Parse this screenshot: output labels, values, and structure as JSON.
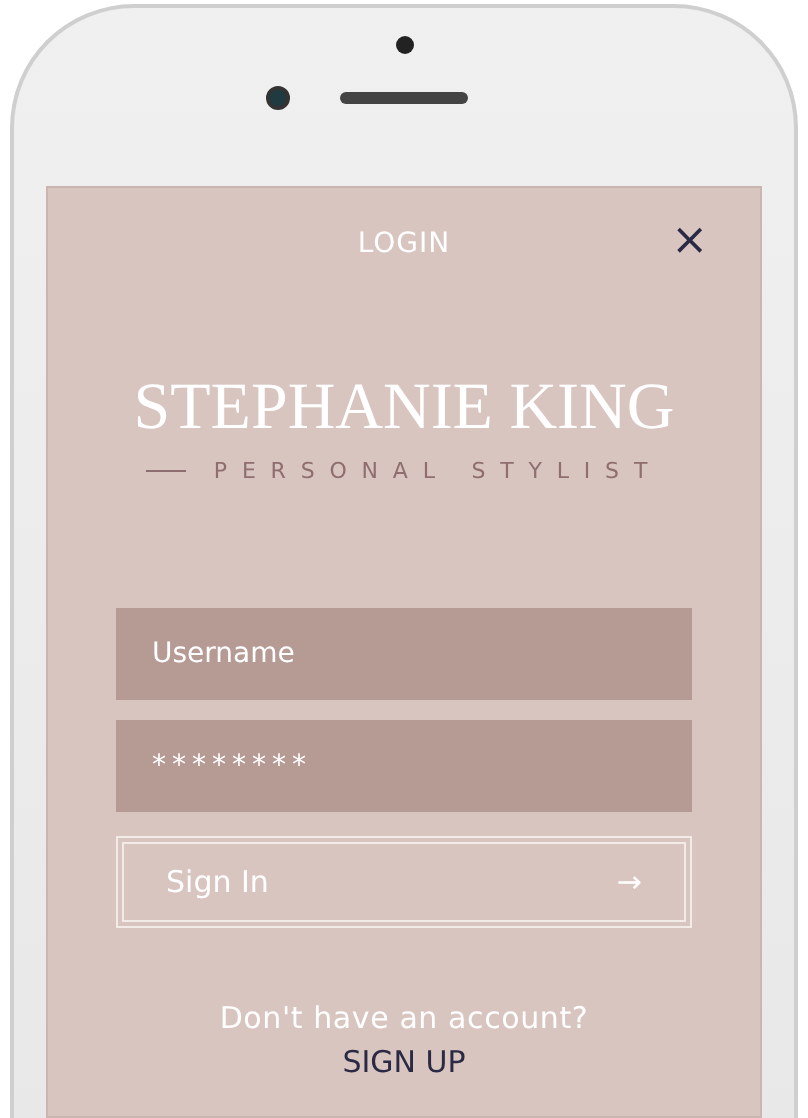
{
  "header": {
    "title": "LOGIN",
    "close": "×"
  },
  "brand": {
    "name": "STEPHANIE KING",
    "tagline": "PERSONAL STYLIST"
  },
  "fields": [
    {
      "kind": "text",
      "placeholder": "Username"
    },
    {
      "kind": "password",
      "value": "********"
    }
  ],
  "sign_in": {
    "label": "Sign In",
    "arrow": "→"
  },
  "footer": {
    "prompt": "Don't have an account?",
    "link": "SIGN UP"
  }
}
